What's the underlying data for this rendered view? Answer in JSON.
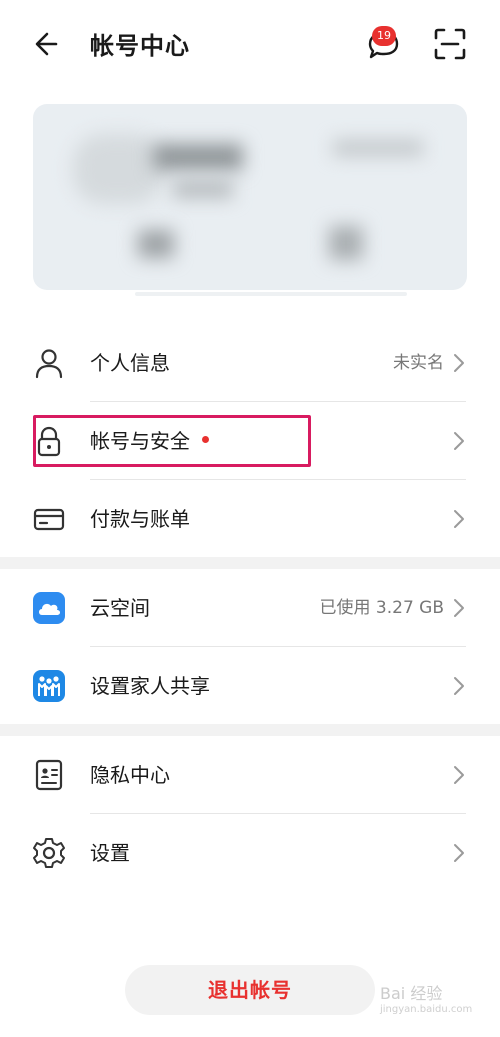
{
  "header": {
    "title": "帐号中心",
    "message_badge": "19"
  },
  "groups": {
    "account": [
      {
        "label": "个人信息",
        "value": "未实名",
        "icon": "person-icon"
      },
      {
        "label": "帐号与安全",
        "value": "",
        "icon": "lock-icon",
        "new_dot": true
      },
      {
        "label": "付款与账单",
        "value": "",
        "icon": "card-icon"
      }
    ],
    "services": [
      {
        "label": "云空间",
        "value": "已使用 3.27 GB",
        "icon": "cloud-icon"
      },
      {
        "label": "设置家人共享",
        "value": "",
        "icon": "family-icon"
      }
    ],
    "settings": [
      {
        "label": "隐私中心",
        "value": "",
        "icon": "privacy-icon"
      },
      {
        "label": "设置",
        "value": "",
        "icon": "gear-icon"
      }
    ]
  },
  "logout_label": "退出帐号",
  "watermark": {
    "line1": "Bai 经验",
    "line2": "jingyan.baidu.com"
  },
  "colors": {
    "accent_red": "#e8312f",
    "highlight_box": "#d81b60",
    "cloud_blue": "#2e8cf0",
    "family_blue": "#1e88e5"
  }
}
